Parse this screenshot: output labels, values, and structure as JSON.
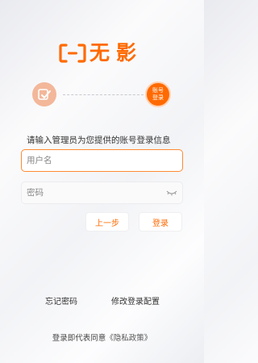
{
  "brand": {
    "name": "无影",
    "color": "#ff6a00"
  },
  "steps": {
    "current_label": "账号登录",
    "completed_icon": "check-icon"
  },
  "form": {
    "prompt": "请输入管理员为您提供的账号登录信息",
    "username": {
      "placeholder": "用户名",
      "value": ""
    },
    "password": {
      "placeholder": "密码",
      "value": ""
    }
  },
  "buttons": {
    "prev_label": "上一步",
    "login_label": "登录"
  },
  "links": {
    "forgot_password": "忘记密码",
    "modify_config": "修改登录配置"
  },
  "agreement": {
    "text": "登录即代表同意",
    "policy_link": "《隐私政策》"
  }
}
